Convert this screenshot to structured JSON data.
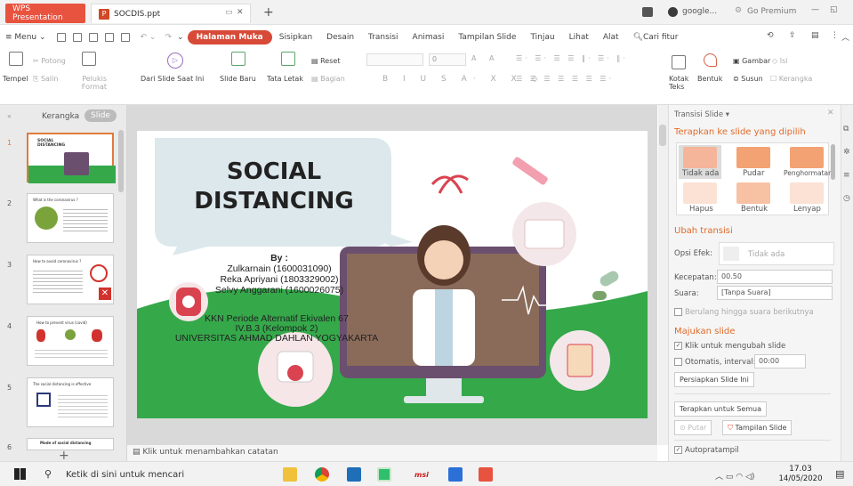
{
  "titlebar": {
    "home_tab": "WPS Presentation",
    "doc_tab": "SOCDIS.ppt",
    "google_label": "google...",
    "premium_label": "Go Premium"
  },
  "menu": {
    "menu_label": "Menu",
    "items": [
      "Halaman Muka",
      "Sisipkan",
      "Desain",
      "Transisi",
      "Animasi",
      "Tampilan Slide",
      "Tinjau",
      "Lihat",
      "Alat"
    ],
    "search": "Cari fitur"
  },
  "ribbon": {
    "tempel": "Tempel",
    "potong": "Potong",
    "salin": "Salin",
    "pelukis": "Pelukis Format",
    "dari_slide": "Dari Slide Saat Ini",
    "slide_baru": "Slide Baru",
    "tata_letak": "Tata Letak",
    "reset": "Reset",
    "bagian": "Bagian",
    "font_size": "0",
    "kotak_teks": "Kotak Teks",
    "bentuk": "Bentuk",
    "susun": "Susun",
    "gambar": "Gambar",
    "isi": "Isi",
    "kerangka": "Kerangka"
  },
  "leftpane": {
    "tab_kerangka": "Kerangka",
    "tab_slide": "Slide",
    "numbers": [
      "1",
      "2",
      "3",
      "4",
      "5",
      "6"
    ]
  },
  "slide": {
    "title_line1": "SOCIAL",
    "title_line2": "DISTANCING",
    "by": "By :",
    "authors": [
      "Zulkarnain (1600031090)",
      "Reka Apriyani (1803329002)",
      "Selvy Anggarani (1600026075)"
    ],
    "program": [
      "KKN Periode Alternatif Ekivalen 67",
      "IV.B.3 (Kelompok 2)",
      "UNIVERSITAS AHMAD DAHLAN YOGYAKARTA"
    ],
    "thumb_titles": [
      "SOCIAL DISTANCING",
      "What is the coronavirus ?",
      "How to avoid coronavirus ?",
      "How to prevent virus (covid)",
      "The social distancing is effective",
      "Mode of social distancing"
    ]
  },
  "rightpane": {
    "title": "Transisi Slide",
    "apply_header": "Terapkan ke slide yang dipilih",
    "transitions": [
      "Tidak ada",
      "Pudar",
      "Penghormatan",
      "Hapus",
      "Bentuk",
      "Lenyap"
    ],
    "ubah_header": "Ubah transisi",
    "opsi_efek_label": "Opsi Efek:",
    "opsi_efek_value": "Tidak ada",
    "kecepatan_label": "Kecepatan:",
    "kecepatan_value": "00.50",
    "suara_label": "Suara:",
    "suara_value": "[Tanpa Suara]",
    "berulang": "Berulang hingga suara berikutnya",
    "majukan_header": "Majukan slide",
    "klik": "Klik untuk mengubah slide",
    "otomatis": "Otomatis, interval:",
    "interval_value": "00:00",
    "persiapkan": "Persiapkan Slide Ini",
    "terapkan_semua": "Terapkan untuk Semua",
    "putar": "Putar",
    "tampilan_slide": "Tampilan Slide",
    "autopratampil": "Autopratampil"
  },
  "notes": {
    "placeholder": "Klik untuk menambahkan catatan"
  },
  "taskbar": {
    "search": "Ketik di sini untuk mencari",
    "time": "17.03",
    "date": "14/05/2020",
    "msi": "msi"
  },
  "colors": {
    "accent": "#e8533f",
    "slide_green": "#35a84a",
    "slide_bubble": "#dde8ec",
    "transition_orange": "#e07b39"
  }
}
